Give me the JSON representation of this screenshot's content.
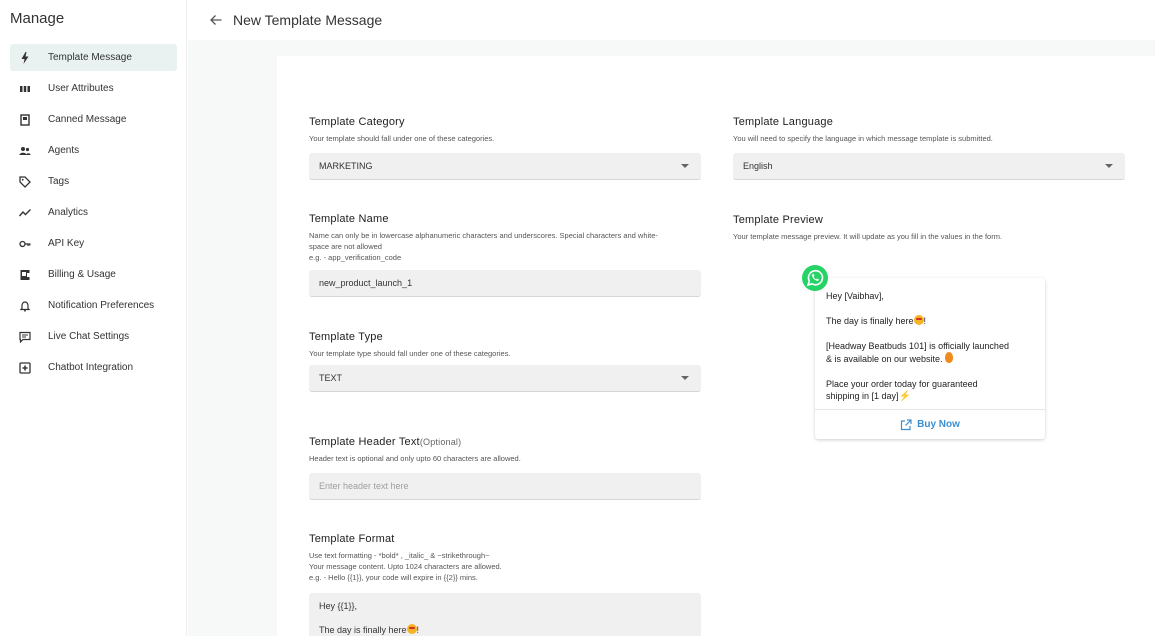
{
  "sidebar": {
    "title": "Manage",
    "items": [
      {
        "label": "Template Message",
        "icon": "lightning-icon"
      },
      {
        "label": "User Attributes",
        "icon": "columns-icon"
      },
      {
        "label": "Canned Message",
        "icon": "document-icon"
      },
      {
        "label": "Agents",
        "icon": "people-icon"
      },
      {
        "label": "Tags",
        "icon": "tag-icon"
      },
      {
        "label": "Analytics",
        "icon": "trend-icon"
      },
      {
        "label": "API Key",
        "icon": "key-icon"
      },
      {
        "label": "Billing & Usage",
        "icon": "billing-icon"
      },
      {
        "label": "Notification Preferences",
        "icon": "bell-icon"
      },
      {
        "label": "Live Chat Settings",
        "icon": "chat-icon"
      },
      {
        "label": "Chatbot Integration",
        "icon": "plus-box-icon"
      }
    ]
  },
  "header": {
    "title": "New Template Message"
  },
  "form": {
    "category": {
      "label": "Template Category",
      "help": "Your template should fall under one of these categories.",
      "value": "MARKETING"
    },
    "language": {
      "label": "Template Language",
      "help": "You will need to specify the language in which message template is submitted.",
      "value": "English"
    },
    "name": {
      "label": "Template Name",
      "help_1": "Name can only be in lowercase alphanumeric characters and underscores. Special characters and white-",
      "help_2": "space are not allowed",
      "help_3": "e.g. - app_verification_code",
      "value": "new_product_launch_1"
    },
    "preview_section": {
      "label": "Template Preview",
      "help": "Your template message preview. It will update as you fill in the values in the form."
    },
    "type": {
      "label": "Template Type",
      "help": "Your template type should fall under one of these categories.",
      "value": "TEXT"
    },
    "header_text": {
      "label": "Template Header Text",
      "optional": "(Optional)",
      "help": "Header text is optional and only upto 60 characters are allowed.",
      "placeholder": "Enter header text here"
    },
    "format": {
      "label": "Template Format",
      "help_1": "Use text formatting - *bold* , _italic_ & ~strikethrough~",
      "help_2": "Your message content. Upto 1024 characters are allowed.",
      "help_3": "e.g. - Hello {{1}}, your code will expire in {{2}} mins.",
      "line_1": "Hey {{1}},",
      "line_2": "The day is finally here"
    }
  },
  "preview": {
    "greeting": "Hey [Vaibhav],",
    "line_2": "The day is finally here",
    "line_3a": "[Headway Beatbuds 101] is officially launched",
    "line_3b": "& is available on our website.",
    "line_4a": "Place your order today for guaranteed",
    "line_4b": "shipping in [1 day]",
    "button_label": "Buy Now"
  },
  "colors": {
    "active_nav": "#e9f2f1",
    "whatsapp": "#25d366",
    "button_link": "#3b8fd1"
  }
}
